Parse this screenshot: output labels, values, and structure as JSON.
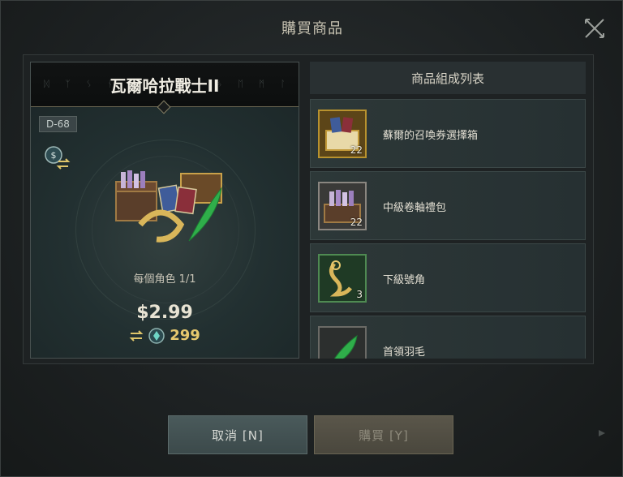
{
  "dialog": {
    "title": "購買商品",
    "close_icon": "close-x-icon"
  },
  "product": {
    "name": "瓦爾哈拉戰士II",
    "tag": "D-68",
    "exchange_icon": "currency-exchange-icon",
    "limit_text": "每個角色 1/1",
    "price": "$2.99",
    "alt_price": {
      "swap_icon": "swap-arrows-icon",
      "coin_icon": "diamond-coin-icon",
      "amount": "299"
    }
  },
  "list": {
    "header": "商品組成列表",
    "items": [
      {
        "name": "蘇爾的召喚券選擇箱",
        "qty": "22",
        "icon": "gold-chest-icon",
        "frame_color": "#b8922e"
      },
      {
        "name": "中級卷軸禮包",
        "qty": "22",
        "icon": "scroll-chest-icon",
        "frame_color": "#8a8680"
      },
      {
        "name": "下級號角",
        "qty": "3",
        "icon": "horn-icon",
        "frame_color": "#4f8a52"
      },
      {
        "name": "首領羽毛",
        "qty": "",
        "icon": "feather-icon",
        "frame_color": "#6a6a66"
      }
    ]
  },
  "buttons": {
    "cancel_label": "取消 [N]",
    "buy_label": "購買 [Y]"
  }
}
